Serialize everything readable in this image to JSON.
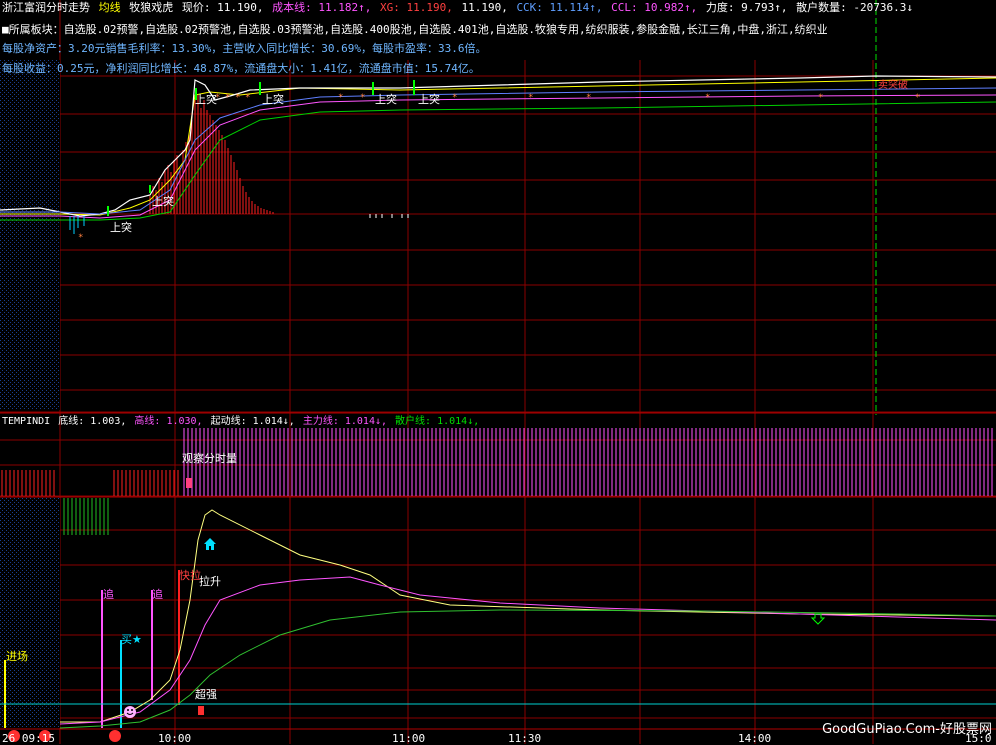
{
  "header": {
    "title": "浙江富润分时走势",
    "avg_line": "均线",
    "indicator": "牧狼戏虎",
    "price_label": "现价: 11.190,",
    "cost_label": "成本线: 11.182↑,",
    "xg_label": "XG: 11.190,",
    "price2": "11.190,",
    "cck_label": "CCK: 11.114↑,",
    "ccl_label": "CCL: 10.982↑,",
    "force_label": "力度: 9.793↑,",
    "retail_label": "散户数量: -20736.3↓"
  },
  "info": {
    "sectors": "■所属板块：自选股.02预警,自选股.02预警池,自选股.03预警池,自选股.400股池,自选股.401池,自选股.牧狼专用,纺织服装,参股金融,长江三角,中盘,浙江,纺织业",
    "line2": "每股净资产：3.20元销售毛利率：13.30%，主营收入同比增长：30.69%，每股市盈率：33.6倍。",
    "line3": "每股收益：0.25元，净利润同比增长：48.87%，流通盘大小：1.41亿，流通盘市值：15.74亿。"
  },
  "chart_labels": {
    "tu1": "上突",
    "tu2": "上突",
    "tu3": "上突",
    "tu4": "上突",
    "tu5": "上突",
    "tu6": "上突",
    "tu7": "上突",
    "buy_top": "卖突破"
  },
  "indicator_row": {
    "name": "TEMPINDI",
    "bottom": "底线: 1.003,",
    "high": "高线: 1.030,",
    "start": "起动线: 1.014↓,",
    "main": "主力线: 1.014↓,",
    "retail": "散户线: 1.014↓,"
  },
  "middle": {
    "watch": "观察分时量"
  },
  "lower_labels": {
    "enter": "进场",
    "chase1": "追",
    "chase2": "追",
    "buy": "买",
    "fast": "快拉",
    "pull": "拉升",
    "strong": "超强"
  },
  "time_axis": {
    "t0": "26 09:15",
    "t1": "10:00",
    "t2": "11:00",
    "t3": "11:30",
    "t4": "14:00",
    "t5": "15:0"
  },
  "watermark": "GoodGuPiao.Com-好股票网",
  "colors": {
    "grid": "#8a0000",
    "vol_red": "#ff2020",
    "magenta": "#ff55ff",
    "green": "#00d000"
  }
}
